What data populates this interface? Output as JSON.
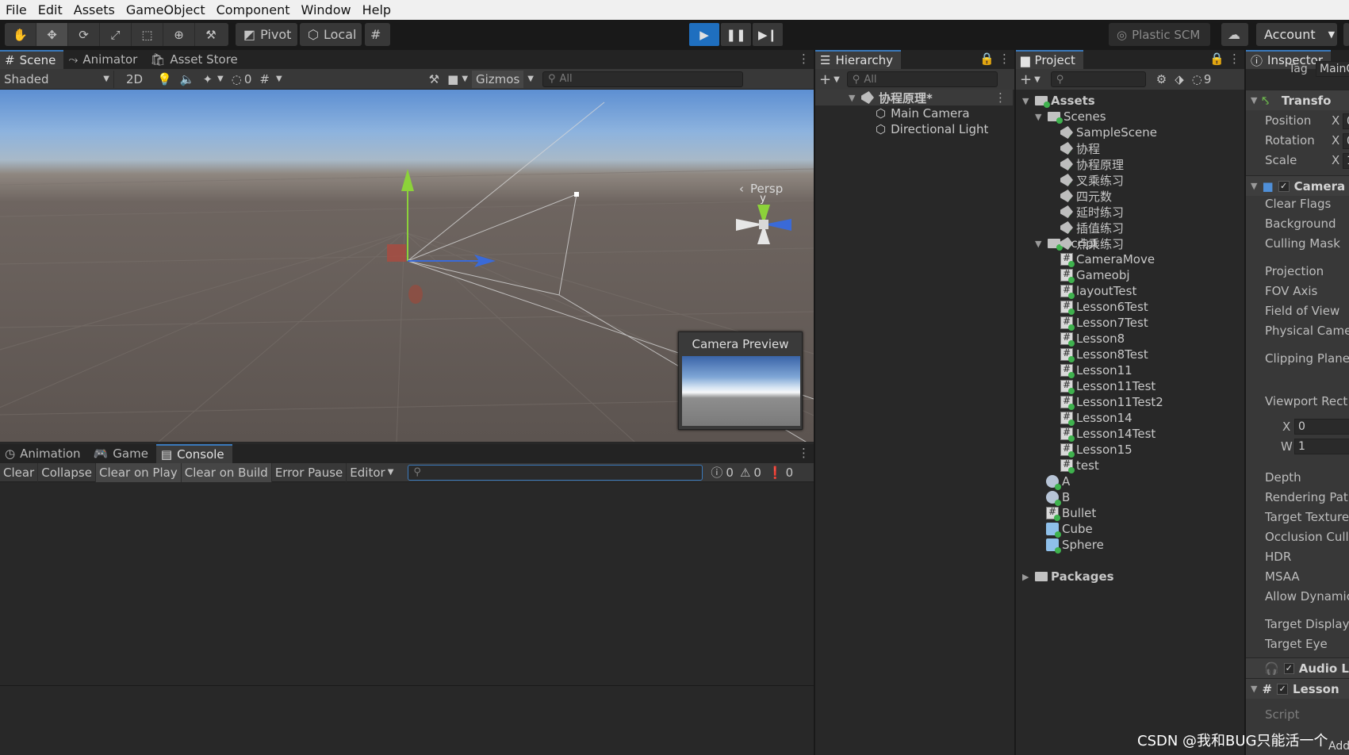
{
  "menu": [
    "File",
    "Edit",
    "Assets",
    "GameObject",
    "Component",
    "Window",
    "Help"
  ],
  "toolbar": {
    "pivot_label": "Pivot",
    "local_label": "Local",
    "plastic_label": "Plastic SCM",
    "account_label": "Account"
  },
  "scene_tabs": [
    "Scene",
    "Animator",
    "Asset Store"
  ],
  "scene_toolbar": {
    "shading": "Shaded",
    "mode_2d": "2D",
    "hidden_count": "0",
    "gizmos": "Gizmos",
    "search_placeholder": "All"
  },
  "scene_view": {
    "gizmo_y_label": "y",
    "persp_label": "Persp",
    "camera_preview_title": "Camera Preview"
  },
  "bottom_tabs": [
    "Animation",
    "Game",
    "Console"
  ],
  "console": {
    "buttons": [
      "Clear",
      "Collapse",
      "Clear on Play",
      "Clear on Build",
      "Error Pause",
      "Editor"
    ],
    "log_count": "0",
    "warn_count": "0",
    "error_count": "0"
  },
  "hierarchy": {
    "tab": "Hierarchy",
    "search_placeholder": "All",
    "scene_name": "协程原理*",
    "items": [
      "Main Camera",
      "Directional Light"
    ]
  },
  "project": {
    "tab": "Project",
    "hidden_count": "9",
    "assets_label": "Assets",
    "scenes_folder": "Scenes",
    "scenes": [
      "SampleScene",
      "协程",
      "协程原理",
      "叉乘练习",
      "四元数",
      "延时练习",
      "插值练习",
      "点乘练习"
    ],
    "script_folder": "Script",
    "scripts": [
      "CameraMove",
      "Gameobj",
      "layoutTest",
      "Lesson6Test",
      "Lesson7Test",
      "Lesson8",
      "Lesson8Test",
      "Lesson11",
      "Lesson11Test",
      "Lesson11Test2",
      "Lesson14",
      "Lesson14Test",
      "Lesson15",
      "test"
    ],
    "root_items": [
      "A",
      "B",
      "Bullet",
      "Cube",
      "Sphere"
    ],
    "packages_label": "Packages"
  },
  "inspector": {
    "tab": "Inspector",
    "tag_label": "Tag",
    "tag_value": "MainC",
    "transform_header": "Transfo",
    "position": "Position",
    "rotation": "Rotation",
    "scale": "Scale",
    "axis_x": "X",
    "pos_x": "0",
    "rot_x": "0",
    "scale_x": "1",
    "camera_header": "Camera",
    "camera_fields": [
      "Clear Flags",
      "Background",
      "Culling Mask",
      "Projection",
      "FOV Axis",
      "Field of View",
      "Physical Came",
      "Clipping Plane",
      "Viewport Rect",
      "Depth",
      "Rendering Path",
      "Target Texture",
      "Occlusion Culli",
      "HDR",
      "MSAA",
      "Allow Dynamic",
      "Target Display",
      "Target Eye"
    ],
    "viewport_x_label": "X",
    "viewport_x": "0",
    "viewport_w_label": "W",
    "viewport_w": "1",
    "audio_header": "Audio L",
    "lesson_header": "Lesson",
    "script_label": "Script",
    "add_label": "Add"
  },
  "watermark": "CSDN @我和BUG只能活一个"
}
